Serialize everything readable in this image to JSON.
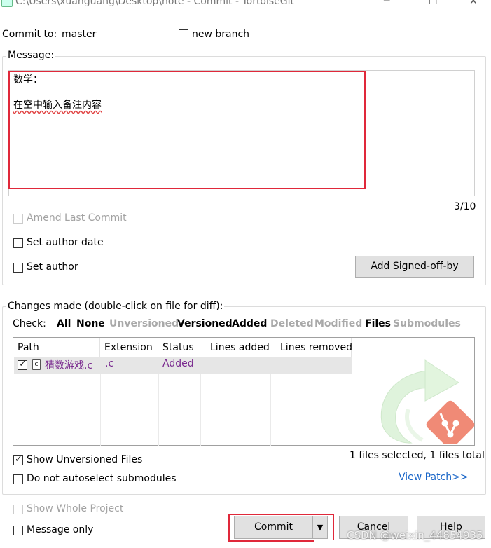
{
  "window": {
    "title": "C:\\Users\\xuanguang\\Desktop\\note - Commit - TortoiseGit"
  },
  "commit_to": {
    "label": "Commit to:",
    "branch": "master",
    "new_branch_label": "new branch",
    "new_branch_checked": false
  },
  "message": {
    "group_label": "Message:",
    "lines": [
      "数学：",
      "在空中输入备注内容"
    ],
    "counter": "3/10"
  },
  "options": {
    "amend_label": "Amend Last Commit",
    "set_author_date_label": "Set author date",
    "set_author_label": "Set author",
    "add_signed_off_label": "Add Signed-off-by"
  },
  "changes": {
    "group_label": "Changes made (double-click on file for diff):",
    "check_label": "Check:",
    "filters": [
      {
        "label": "All",
        "enabled": true
      },
      {
        "label": "None",
        "enabled": true
      },
      {
        "label": "Unversioned",
        "enabled": false
      },
      {
        "label": "Versioned",
        "enabled": true
      },
      {
        "label": "Added",
        "enabled": true
      },
      {
        "label": "Deleted",
        "enabled": false
      },
      {
        "label": "Modified",
        "enabled": false
      },
      {
        "label": "Files",
        "enabled": true
      },
      {
        "label": "Submodules",
        "enabled": false
      }
    ],
    "columns": [
      "Path",
      "Extension",
      "Status",
      "Lines added",
      "Lines removed"
    ],
    "rows": [
      {
        "path": "猜数游戏.c",
        "extension": ".c",
        "status": "Added",
        "lines_added": "",
        "lines_removed": "",
        "checked": true
      }
    ],
    "summary": "1 files selected, 1 files total",
    "show_unversioned_label": "Show Unversioned Files",
    "show_unversioned_checked": true,
    "no_autoselect_label": "Do not autoselect submodules",
    "view_patch_label": "View Patch>>"
  },
  "bottom": {
    "show_whole_project_label": "Show Whole Project",
    "message_only_label": "Message only",
    "commit_label": "Commit",
    "cancel_label": "Cancel",
    "help_label": "Help"
  },
  "watermark": "CSDN @weixin_44854935",
  "colors": {
    "highlight_red": "#e0283a",
    "status_added": "#7a2a8f",
    "link_blue": "#1a66c8"
  }
}
